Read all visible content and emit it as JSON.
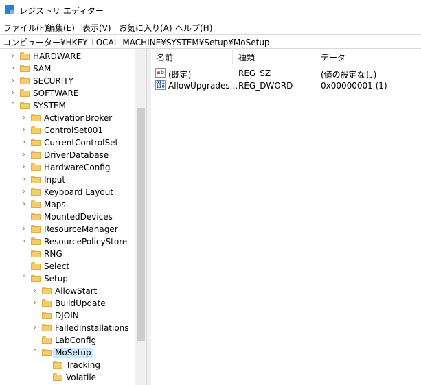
{
  "window": {
    "title": "レジストリ エディター"
  },
  "menu": [
    "ファイル(F)",
    "編集(E)",
    "表示(V)",
    "お気に入り(A)",
    "ヘルプ(H)"
  ],
  "address": "コンピューター¥HKEY_LOCAL_MACHINE¥SYSTEM¥Setup¥MoSetup",
  "tree": [
    {
      "label": "HARDWARE",
      "expanded": false
    },
    {
      "label": "SAM",
      "expanded": false
    },
    {
      "label": "SECURITY",
      "expanded": false
    },
    {
      "label": "SOFTWARE",
      "expanded": false
    },
    {
      "label": "SYSTEM",
      "expanded": true
    },
    {
      "label": "ActivationBroker",
      "expanded": false
    },
    {
      "label": "ControlSet001",
      "expanded": false
    },
    {
      "label": "CurrentControlSet",
      "expanded": false
    },
    {
      "label": "DriverDatabase",
      "expanded": false
    },
    {
      "label": "HardwareConfig",
      "expanded": false
    },
    {
      "label": "Input",
      "expanded": false
    },
    {
      "label": "Keyboard Layout",
      "expanded": false
    },
    {
      "label": "Maps",
      "expanded": false
    },
    {
      "label": "MountedDevices",
      "expanded": false
    },
    {
      "label": "ResourceManager",
      "expanded": false
    },
    {
      "label": "ResourcePolicyStore",
      "expanded": false
    },
    {
      "label": "RNG",
      "expanded": false
    },
    {
      "label": "Select",
      "expanded": false
    },
    {
      "label": "Setup",
      "expanded": true
    },
    {
      "label": "AllowStart",
      "expanded": false
    },
    {
      "label": "BuildUpdate",
      "expanded": false
    },
    {
      "label": "DJOIN",
      "expanded": false
    },
    {
      "label": "FailedInstallations",
      "expanded": false
    },
    {
      "label": "LabConfig",
      "expanded": false
    },
    {
      "label": "MoSetup",
      "expanded": true,
      "selected": true
    },
    {
      "label": "Tracking",
      "expanded": false
    },
    {
      "label": "Volatile",
      "expanded": false
    }
  ],
  "columns": [
    "名前",
    "種類",
    "データ"
  ],
  "values": [
    {
      "icon": "string-value-icon",
      "name": "(既定)",
      "type": "REG_SZ",
      "data": "(値の設定なし)"
    },
    {
      "icon": "dword-value-icon",
      "name": "AllowUpgrades...",
      "type": "REG_DWORD",
      "data": "0x00000001 (1)"
    }
  ]
}
